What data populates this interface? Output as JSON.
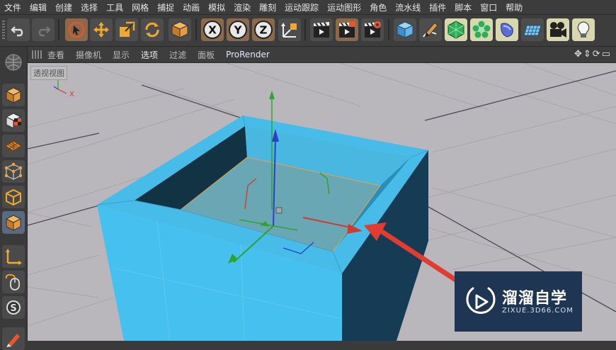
{
  "menu": {
    "items": [
      "文件",
      "编辑",
      "创建",
      "选择",
      "工具",
      "网格",
      "捕捉",
      "动画",
      "模拟",
      "渲染",
      "雕刻",
      "运动跟踪",
      "运动图形",
      "角色",
      "流水线",
      "插件",
      "脚本",
      "窗口",
      "帮助"
    ]
  },
  "toolbar": {
    "icons": [
      "undo-icon",
      "redo-icon",
      "live-selection-icon",
      "move-icon",
      "scale-icon",
      "rotate-icon",
      "model-object-icon",
      "x-axis-icon",
      "y-axis-icon",
      "z-axis-icon",
      "coordinate-system-icon",
      "render-view-icon",
      "render-to-picture-viewer-icon",
      "render-settings-icon",
      "cube-icon",
      "pen-spline-icon",
      "subdivision-surface-icon",
      "cloner-icon",
      "deformer-icon",
      "floor-icon",
      "camera-icon",
      "light-icon"
    ],
    "axis_labels": {
      "x": "X",
      "y": "Y",
      "z": "Z"
    }
  },
  "left_toolbar": {
    "icons": [
      "make-editable-icon",
      "texture-mode-icon",
      "workplane-icon",
      "points-mode-icon",
      "edges-mode-icon",
      "polygons-mode-icon",
      "axis-mode-icon",
      "tweak-mode-icon",
      "solo-icon",
      "paint-icon"
    ]
  },
  "viewport_menu": {
    "items": [
      "查看",
      "摄像机",
      "显示",
      "选项",
      "过滤",
      "面板",
      "ProRender"
    ],
    "active": "选项"
  },
  "viewport": {
    "label": "透视视图",
    "axis_x": "X",
    "background": "#b9b6bc",
    "object_color": "#47bce8",
    "selected_face_color": "#6aa7b4"
  },
  "watermark": {
    "title": "溜溜自学",
    "subtitle": "ZIXUE.3D66.COM"
  },
  "colors": {
    "axis_x": "#d23a2a",
    "axis_y": "#2da52d",
    "axis_z": "#2a3fd2",
    "arrow": "#e23b30"
  }
}
